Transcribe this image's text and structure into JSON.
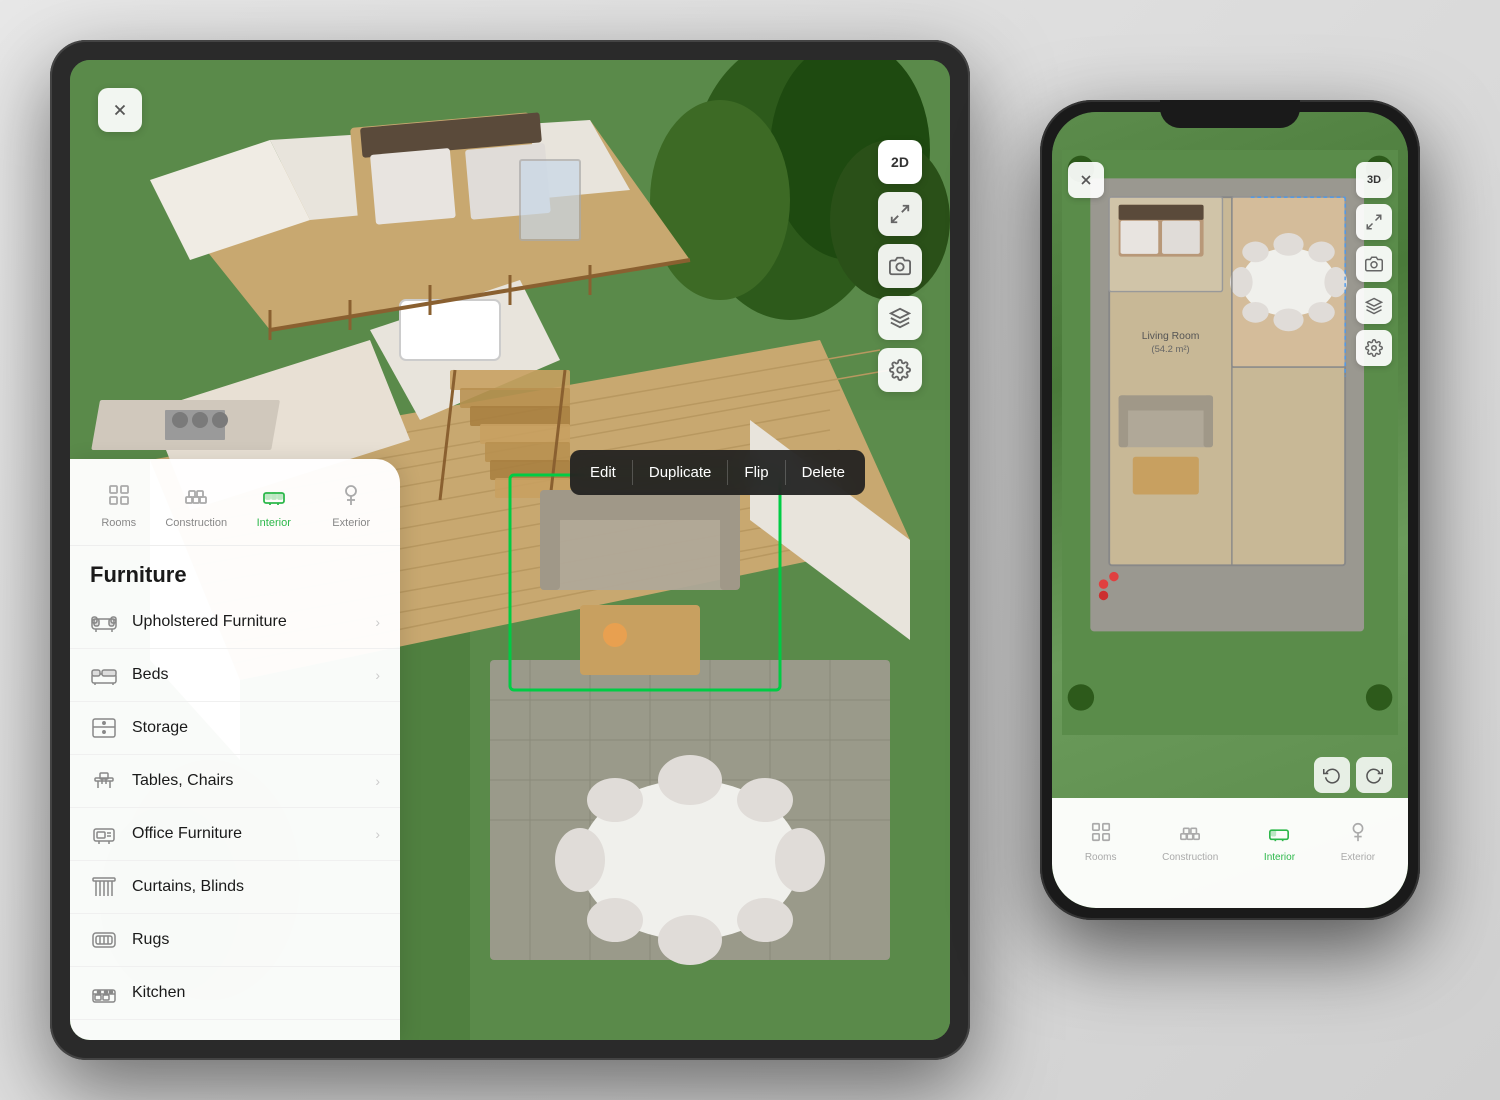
{
  "scene": {
    "background_color": "#e8e8e8"
  },
  "tablet": {
    "close_btn": "✕",
    "view_mode": "2D",
    "toolbar_icons": [
      "fullscreen",
      "camera",
      "layers",
      "settings"
    ],
    "context_menu": {
      "items": [
        "Edit",
        "Duplicate",
        "Flip",
        "Delete"
      ]
    },
    "furniture_panel": {
      "categories": [
        {
          "label": "Rooms",
          "icon": "🏠",
          "active": false
        },
        {
          "label": "Construction",
          "icon": "🧱",
          "active": false
        },
        {
          "label": "Interior",
          "icon": "🪑",
          "active": true
        },
        {
          "label": "Exterior",
          "icon": "🌳",
          "active": false
        }
      ],
      "section_title": "Furniture",
      "items": [
        {
          "label": "Upholstered Furniture",
          "has_chevron": true
        },
        {
          "label": "Beds",
          "has_chevron": true
        },
        {
          "label": "Storage",
          "has_chevron": false
        },
        {
          "label": "Tables, Chairs",
          "has_chevron": true
        },
        {
          "label": "Office Furniture",
          "has_chevron": true
        },
        {
          "label": "Curtains, Blinds",
          "has_chevron": false
        },
        {
          "label": "Rugs",
          "has_chevron": false
        },
        {
          "label": "Kitchen",
          "has_chevron": false
        }
      ]
    }
  },
  "phone": {
    "close_btn": "✕",
    "view_mode": "3D",
    "room_label": "Living Room (54.2 m²)",
    "nav_items": [
      {
        "label": "Rooms",
        "icon": "🏠",
        "active": false
      },
      {
        "label": "Construction",
        "icon": "🧱",
        "active": false
      },
      {
        "label": "Interior",
        "icon": "🪑",
        "active": true
      },
      {
        "label": "Exterior",
        "icon": "🌳",
        "active": false
      }
    ],
    "undo_icon": "↩",
    "redo_icon": "↪"
  }
}
